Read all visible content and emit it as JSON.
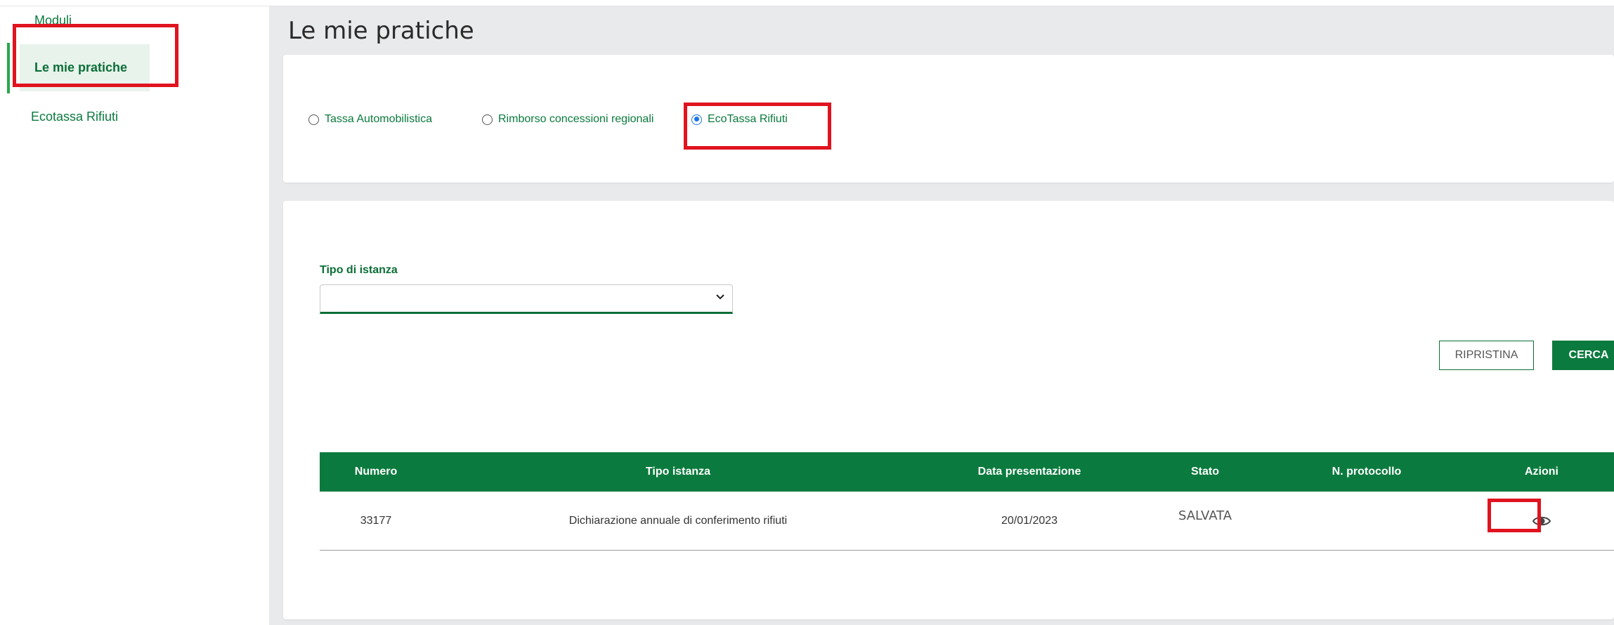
{
  "sidebar": {
    "items": [
      {
        "label": "Moduli"
      },
      {
        "label": "Le mie pratiche"
      },
      {
        "label": "Ecotassa Rifiuti"
      }
    ]
  },
  "page": {
    "title": "Le mie pratiche"
  },
  "filters": {
    "radios": [
      {
        "label": "Tassa Automobilistica",
        "checked": false
      },
      {
        "label": "Rimborso concessioni regionali",
        "checked": false
      },
      {
        "label": "EcoTassa Rifiuti",
        "checked": true
      }
    ]
  },
  "form": {
    "tipo_label": "Tipo di istanza",
    "tipo_value": "",
    "reset_label": "RIPRISTINA",
    "search_label": "CERCA"
  },
  "table": {
    "headers": [
      "Numero",
      "Tipo istanza",
      "Data presentazione",
      "Stato",
      "N. protocollo",
      "Azioni"
    ],
    "rows": [
      {
        "numero": "33177",
        "tipo": "Dichiarazione annuale di conferimento rifiuti",
        "data": "20/01/2023",
        "stato": "SALVATA",
        "protocollo": ""
      }
    ]
  },
  "colors": {
    "brand_green": "#0b7a3e",
    "highlight_red": "#e0131f",
    "radio_blue": "#1a73e8"
  },
  "icons": {
    "view": "eye-icon",
    "dropdown": "chevron-down-icon"
  }
}
